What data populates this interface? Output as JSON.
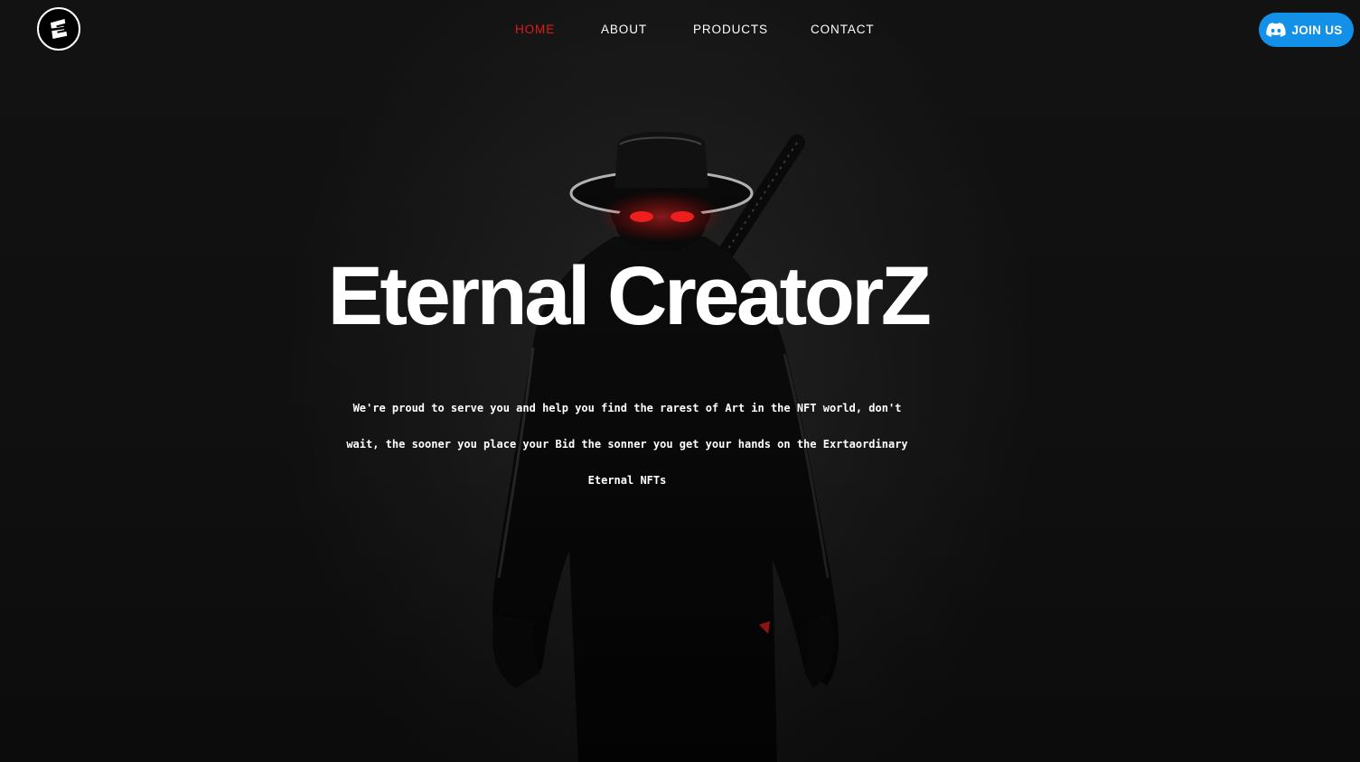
{
  "header": {
    "logo_icon": "eternal-creatorz-logo-icon",
    "nav": [
      {
        "label": "HOME",
        "active": true
      },
      {
        "label": "ABOUT",
        "active": false
      },
      {
        "label": "PRODUCTS",
        "active": false
      },
      {
        "label": "CONTACT",
        "active": false
      }
    ],
    "join_button": {
      "label": "JOIN US",
      "icon": "discord-icon"
    }
  },
  "hero": {
    "title": "Eternal CreatorZ",
    "description": "We're proud to serve you and help you find the rarest of Art in the NFT world, don't wait, the sooner you place your Bid the sonner you get your hands on the Exrtaordinary Eternal NFTs"
  },
  "colors": {
    "accent_active": "#e01b1b",
    "button": "#1391e8",
    "background": "#141414",
    "text": "#ffffff",
    "eyes": "#ff1a1a"
  }
}
